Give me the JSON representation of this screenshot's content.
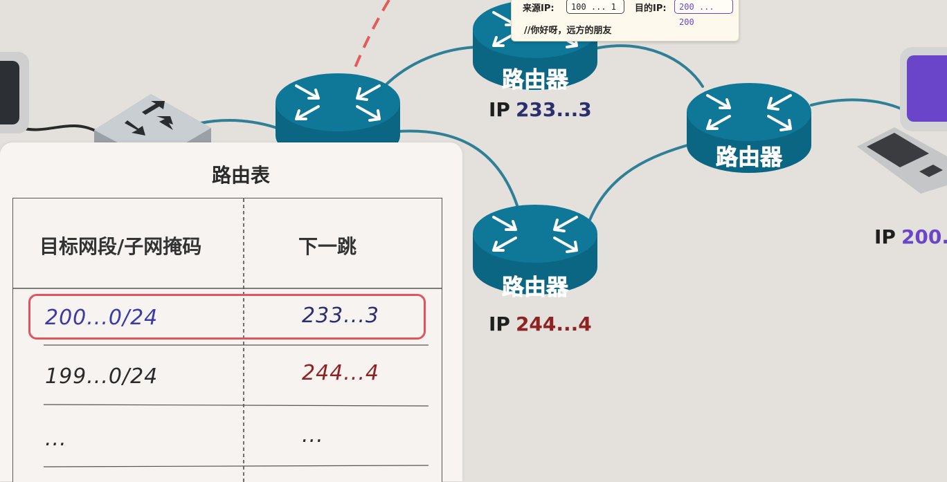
{
  "colors": {
    "background": "#e4e1dc",
    "router": "#0d7191",
    "link": "#2f7f96",
    "blue_value": "#3b3ba8",
    "red_value": "#8f2222",
    "purple_value": "#6b45c9",
    "highlight": "#e0545c",
    "dashed_path": "#e45b5b"
  },
  "routers": {
    "router_label": "路由器",
    "top_ip_prefix": "IP",
    "top_ip_value": "233...3",
    "bottom_ip_prefix": "IP",
    "bottom_ip_value": "244...4"
  },
  "destination": {
    "ip_prefix": "IP",
    "ip_value": "200."
  },
  "packet": {
    "source_label": "来源IP:",
    "source_value": "100 ... 1",
    "dest_label": "目的IP:",
    "dest_value": "200 ... 200",
    "message": "//你好呀，远方的朋友"
  },
  "routing_table": {
    "title": "路由表",
    "headers": [
      "目标网段/子网掩码",
      "下一跳"
    ],
    "rows": [
      {
        "dest": "200...0/24",
        "next_hop": "233...3",
        "highlighted": true
      },
      {
        "dest": "199...0/24",
        "next_hop": "244...4",
        "highlighted": false
      },
      {
        "dest": "...",
        "next_hop": "...",
        "highlighted": false
      }
    ]
  },
  "icons": [
    "router-icon",
    "switch-icon",
    "monitor-icon",
    "keyboard-icon"
  ]
}
